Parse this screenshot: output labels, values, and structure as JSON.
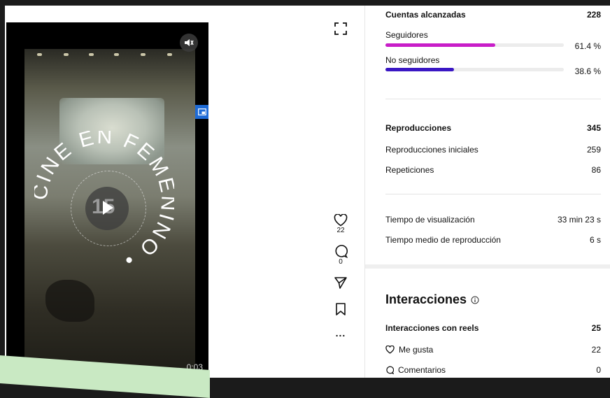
{
  "video": {
    "time": "0:03",
    "overlay_circle_text": "CINE EN FEMENINO •",
    "play_number": "15"
  },
  "actions": {
    "likes_count": "22",
    "comments_count": "0",
    "more_label": "..."
  },
  "stats": {
    "reach": {
      "label": "Cuentas alcanzadas",
      "value": "228"
    },
    "followers": {
      "label": "Seguidores",
      "percent": "61.4 %",
      "fraction": 0.614,
      "color": "#c81dc8"
    },
    "non_followers": {
      "label": "No seguidores",
      "percent": "38.6 %",
      "fraction": 0.386,
      "color": "#3a17c4"
    },
    "plays": {
      "label": "Reproducciones",
      "value": "345"
    },
    "initial_plays": {
      "label": "Reproducciones iniciales",
      "value": "259"
    },
    "replays": {
      "label": "Repeticiones",
      "value": "86"
    },
    "watch_time": {
      "label": "Tiempo de visualización",
      "value": "33 min 23 s"
    },
    "avg_watch_time": {
      "label": "Tiempo medio de reproducción",
      "value": "6 s"
    },
    "interactions_title": "Interacciones",
    "reel_interactions": {
      "label": "Interacciones con reels",
      "value": "25"
    },
    "likes": {
      "label": "Me gusta",
      "value": "22"
    },
    "comments": {
      "label": "Comentarios",
      "value": "0"
    }
  }
}
